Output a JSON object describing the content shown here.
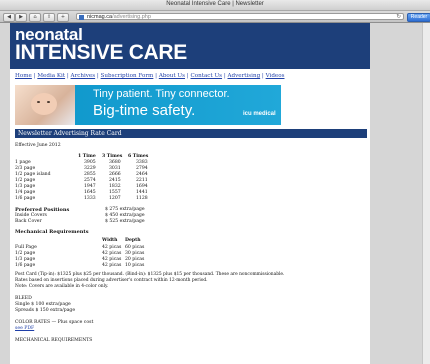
{
  "window": {
    "title": "Neonatal Intensive Care | Newsletter"
  },
  "toolbar": {
    "url_domain": "nicmag.ca",
    "url_path": "/advertising.php",
    "reader_label": "Reader"
  },
  "site": {
    "logo_line1": "neonatal",
    "logo_line2": "INTENSIVE CARE",
    "nav": [
      "Home",
      "Media Kit",
      "Archives",
      "Subscription Form",
      "About Us",
      "Contact Us",
      "Advertising",
      "Videos"
    ]
  },
  "banner": {
    "line1": "Tiny patient. Tiny connector.",
    "line2": "Big-time safety.",
    "brand": "icu medical"
  },
  "section_title": "Newsletter Advertising Rate Card",
  "effective": "Effective June 2012",
  "rates": {
    "headers": [
      "1 Time",
      "3 Times",
      "6 Times"
    ],
    "rows": [
      {
        "label": "1 page",
        "values": [
          "3905",
          "3680",
          "3383"
        ]
      },
      {
        "label": "2/3 page",
        "values": [
          "3229",
          "3031",
          "2794"
        ]
      },
      {
        "label": "1/2 page island",
        "values": [
          "2855",
          "2666",
          "2464"
        ]
      },
      {
        "label": "1/2 page",
        "values": [
          "2574",
          "2415",
          "2211"
        ]
      },
      {
        "label": "1/3 page",
        "values": [
          "1947",
          "1832",
          "1694"
        ]
      },
      {
        "label": "1/4 page",
        "values": [
          "1645",
          "1557",
          "1441"
        ]
      },
      {
        "label": "1/6 page",
        "values": [
          "1333",
          "1207",
          "1128"
        ]
      }
    ]
  },
  "positions": {
    "title": "Preferred Positions",
    "first_value": "$ 275 extra/page",
    "rows": [
      {
        "label": "Inside Covers",
        "value": "$ 450 extra/page"
      },
      {
        "label": "Back Cover",
        "value": "$ 525 extra/page"
      }
    ]
  },
  "mechanical": {
    "title": "Mechanical Requirements",
    "headers": [
      "Width",
      "Depth"
    ],
    "rows": [
      {
        "label": "Full Page",
        "width": "42 picas",
        "depth": "60 picas"
      },
      {
        "label": "1/2 page",
        "width": "42 picas",
        "depth": "30 picas"
      },
      {
        "label": "1/3 page",
        "width": "42 picas",
        "depth": "20 picas"
      },
      {
        "label": "1/6 page",
        "width": "42 picas",
        "depth": "10 picas"
      }
    ]
  },
  "notes": [
    "Post Card (Tip-in): $1325 plus $25 per thousand. (Bind-in): $1325 plus $15 per thousand. These are noncommissionable.",
    "Rates based on insertions placed during advertiser's contract within 12-month period.",
    "Note: Covers are available in 4-color only."
  ],
  "bleed": {
    "title": "BLEED",
    "lines": [
      "Single $ 100 extra/page",
      "Spreads $ 150 extra/page"
    ]
  },
  "color": {
    "line": "COLOR RATES — Plus space cost",
    "link": "see PDF"
  },
  "mech_footer": "MECHANICAL REQUIREMENTS"
}
